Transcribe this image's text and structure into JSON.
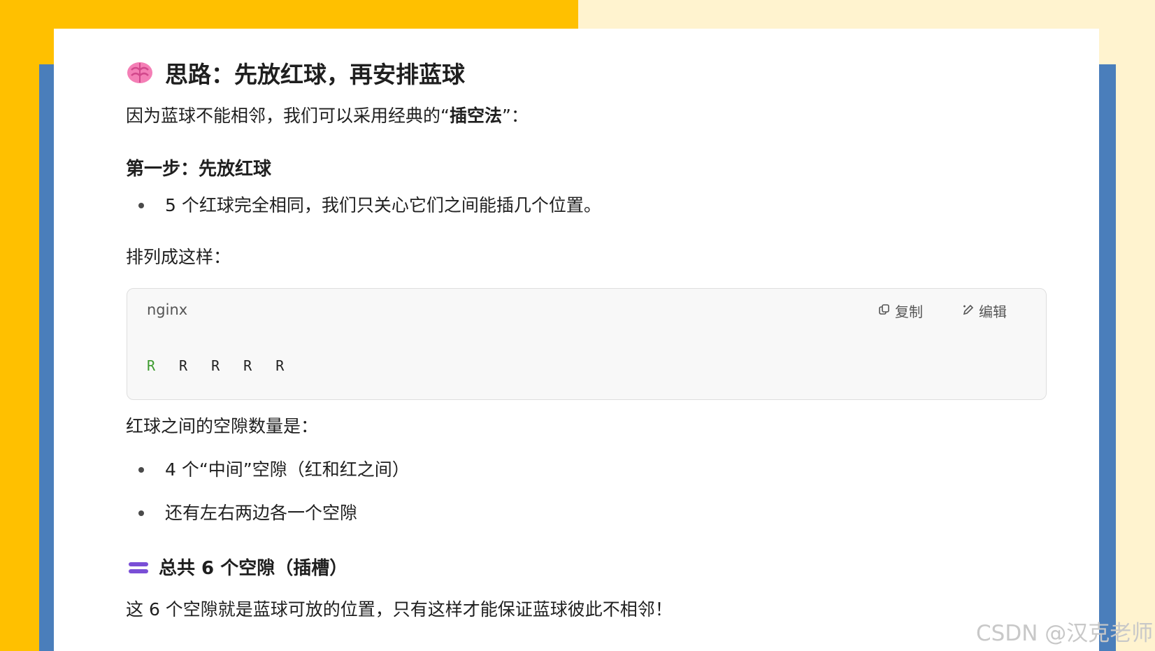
{
  "heading": {
    "icon": "brain-icon",
    "text": "思路：先放红球，再安排蓝球"
  },
  "intro": {
    "prefix": "因为蓝球不能相邻，我们可以采用经典的“",
    "bold": "插空法",
    "suffix": "”："
  },
  "step1": {
    "title": "第一步：先放红球",
    "bullets": [
      "5 个红球完全相同，我们只关心它们之间能插几个位置。"
    ]
  },
  "arrange_text": "排列成这样：",
  "code_block": {
    "language": "nginx",
    "copy_label": "复制",
    "edit_label": "编辑",
    "tokens": [
      "R",
      "R",
      "R",
      "R",
      "R"
    ],
    "colors": {
      "first_token": "#3c9b2e",
      "rest": "#222222"
    }
  },
  "gaps_text": "红球之间的空隙数量是：",
  "gaps_bullets": [
    "4 个“中间”空隙（红和红之间）",
    "还有左右两边各一个空隙"
  ],
  "total": {
    "icon": "equals-icon",
    "text": "总共 6 个空隙（插槽）"
  },
  "conclusion": "这 6 个空隙就是蓝球可放的位置，只有这样才能保证蓝球彼此不相邻！",
  "watermark": "CSDN @汉克老师",
  "colors": {
    "yellow": "#ffc000",
    "cream": "#fff3cf",
    "blue": "#4a7ebb",
    "equals_purple": "#7a4fd6"
  }
}
